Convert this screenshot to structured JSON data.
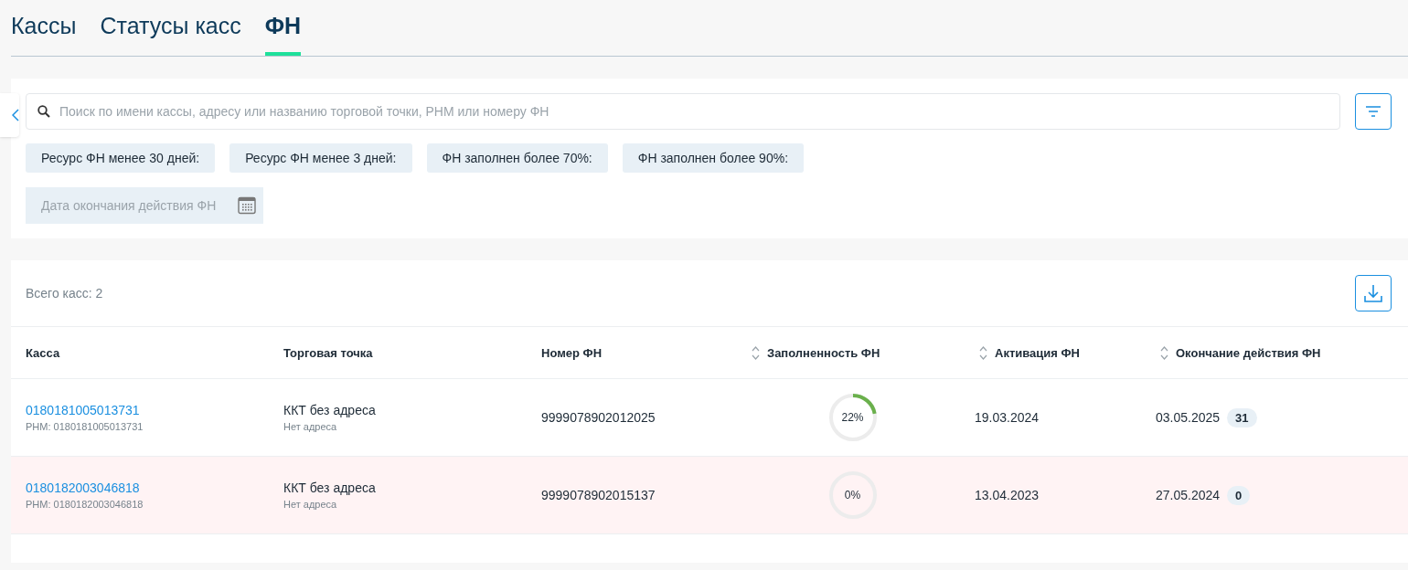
{
  "tabs": [
    {
      "label": "Кассы",
      "selected": false
    },
    {
      "label": "Статусы касс",
      "selected": false
    },
    {
      "label": "ФН",
      "selected": true
    }
  ],
  "search": {
    "placeholder": "Поиск по имени кассы, адресу или названию торговой точки, РНМ или номеру ФН"
  },
  "filter_chips": [
    "Ресурс ФН менее 30 дней:",
    "Ресурс ФН менее 3 дней:",
    "ФН заполнен более 70%:",
    "ФН заполнен более 90%:"
  ],
  "date_field": {
    "placeholder": "Дата окончания действия ФН"
  },
  "total": "Всего касс: 2",
  "table": {
    "columns": [
      {
        "label": "Касса",
        "sortable": false
      },
      {
        "label": "Торговая точка",
        "sortable": false
      },
      {
        "label": "Номер ФН",
        "sortable": false
      },
      {
        "label": "Заполненность ФН",
        "sortable": true
      },
      {
        "label": "Активация ФН",
        "sortable": true
      },
      {
        "label": "Окончание действия ФН",
        "sortable": true
      }
    ],
    "rows": [
      {
        "kassa": "0180181005013731",
        "rnm": "РНМ: 0180181005013731",
        "store": "ККТ без адреса",
        "address": "Нет адреса",
        "fn_number": "9999078902012025",
        "fill_text": "22%",
        "level": 0.22,
        "activation": "19.03.2024",
        "end_date": "03.05.2025",
        "days_left": "31",
        "expired": false
      },
      {
        "kassa": "0180182003046818",
        "rnm": "РНМ: 0180182003046818",
        "store": "ККТ без адреса",
        "address": "Нет адреса",
        "fn_number": "9999078902015137",
        "fill_text": "0%",
        "level": 0,
        "activation": "13.04.2023",
        "end_date": "27.05.2024",
        "days_left": "0",
        "expired": true
      }
    ]
  }
}
